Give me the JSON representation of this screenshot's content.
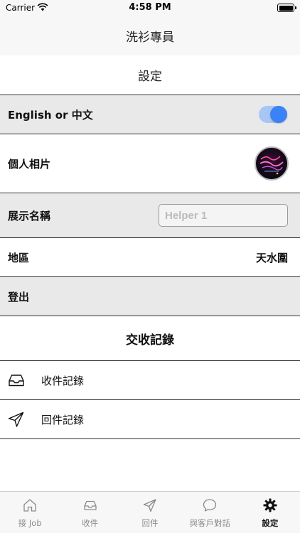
{
  "status_bar": {
    "carrier": "Carrier",
    "time": "4:58 PM"
  },
  "nav": {
    "title": "洗衫專員"
  },
  "settings": {
    "header": "設定",
    "language_label": "English or 中文",
    "language_toggle_on": true,
    "photo_label": "個人相片",
    "photo_icon": "avatar-image",
    "display_name_label": "展示名稱",
    "display_name_placeholder": "Helper 1",
    "region_label": "地區",
    "region_value": "天水圍",
    "logout_label": "登出"
  },
  "records": {
    "header": "交收記錄",
    "items": [
      {
        "icon": "inbox-icon",
        "label": "收件記錄"
      },
      {
        "icon": "paper-plane-icon",
        "label": "回件記錄"
      }
    ]
  },
  "tab_bar": {
    "items": [
      {
        "icon": "home-icon",
        "label": "接 Job"
      },
      {
        "icon": "inbox-icon",
        "label": "收件"
      },
      {
        "icon": "paper-plane-icon",
        "label": "回件"
      },
      {
        "icon": "chat-icon",
        "label": "與客戶對話"
      },
      {
        "icon": "gear-icon",
        "label": "設定"
      }
    ],
    "active_index": 4
  },
  "colors": {
    "toggle_on": "#3b82f6",
    "toggle_track": "#a8c6f3",
    "row_gray": "#e9e9e9",
    "bar_bg": "#f7f7f7"
  }
}
